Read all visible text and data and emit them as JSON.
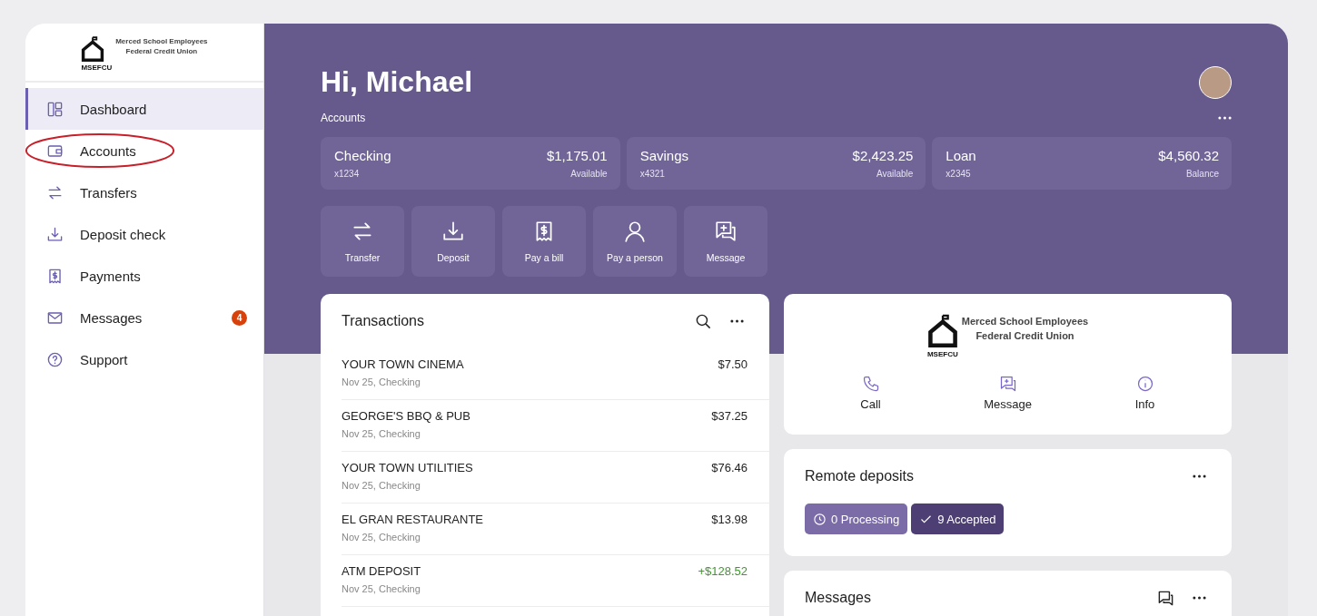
{
  "sidebar": {
    "logo": {
      "lines": [
        "Merced School Employees",
        "Federal Credit Union"
      ],
      "abbr": "MSEFCU"
    },
    "items": [
      {
        "label": "Dashboard",
        "kind": "dashboard",
        "selected": true,
        "circled": false
      },
      {
        "label": "Accounts",
        "kind": "wallet",
        "selected": false,
        "circled": true
      },
      {
        "label": "Transfers",
        "kind": "transfer",
        "selected": false,
        "circled": false
      },
      {
        "label": "Deposit check",
        "kind": "deposit",
        "selected": false,
        "circled": false
      },
      {
        "label": "Payments",
        "kind": "bill",
        "selected": false,
        "circled": false
      },
      {
        "label": "Messages",
        "kind": "mail",
        "selected": false,
        "circled": false,
        "badge": "4"
      },
      {
        "label": "Support",
        "kind": "help",
        "selected": false,
        "circled": false
      }
    ]
  },
  "header": {
    "greeting": "Hi, Michael",
    "section": "Accounts"
  },
  "accounts": [
    {
      "name": "Checking",
      "number": "x1234",
      "amount": "$1,175.01",
      "note": "Available"
    },
    {
      "name": "Savings",
      "number": "x4321",
      "amount": "$2,423.25",
      "note": "Available"
    },
    {
      "name": "Loan",
      "number": "x2345",
      "amount": "$4,560.32",
      "note": "Balance"
    }
  ],
  "actions": [
    {
      "label": "Transfer",
      "kind": "transfer"
    },
    {
      "label": "Deposit",
      "kind": "deposit"
    },
    {
      "label": "Pay a bill",
      "kind": "bill"
    },
    {
      "label": "Pay a person",
      "kind": "person"
    },
    {
      "label": "Message",
      "kind": "message"
    }
  ],
  "transactions": {
    "title": "Transactions",
    "rows": [
      {
        "name": "YOUR TOWN CINEMA",
        "detail": "Nov 25, Checking",
        "amount": "$7.50",
        "credit": false
      },
      {
        "name": "GEORGE'S BBQ & PUB",
        "detail": "Nov 25, Checking",
        "amount": "$37.25",
        "credit": false
      },
      {
        "name": "YOUR TOWN UTILITIES",
        "detail": "Nov 25, Checking",
        "amount": "$76.46",
        "credit": false
      },
      {
        "name": "EL GRAN RESTAURANTE",
        "detail": "Nov 25, Checking",
        "amount": "$13.98",
        "credit": false
      },
      {
        "name": "ATM DEPOSIT",
        "detail": "Nov 25, Checking",
        "amount": "+$128.52",
        "credit": true
      }
    ]
  },
  "contact": {
    "logo": {
      "lines": [
        "Merced School Employees",
        "Federal Credit Union"
      ],
      "abbr": "MSEFCU"
    },
    "actions": [
      {
        "label": "Call",
        "kind": "phone"
      },
      {
        "label": "Message",
        "kind": "message"
      },
      {
        "label": "Info",
        "kind": "info"
      }
    ]
  },
  "remote_deposits": {
    "title": "Remote deposits",
    "chips": [
      {
        "label": "0 Processing",
        "kind": "processing"
      },
      {
        "label": "9 Accepted",
        "kind": "accepted"
      }
    ]
  },
  "messages": {
    "title": "Messages"
  }
}
